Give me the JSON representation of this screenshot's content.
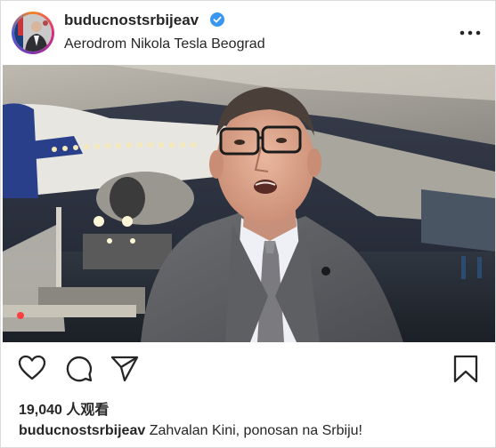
{
  "post": {
    "username": "buducnostsrbijeav",
    "location": "Aerodrom Nikola Tesla Beograd",
    "views": "19,040 人观看",
    "caption_user": "buducnostsrbijeav",
    "caption_text": "Zahvalan Kini, ponosan na Srbiju!",
    "icons": {
      "verified": "verified-badge-icon",
      "more": "more-options-icon",
      "like": "heart-icon",
      "comment": "comment-bubble-icon",
      "share": "paper-plane-icon",
      "save": "bookmark-icon"
    },
    "colors": {
      "verified": "#3897f0",
      "text": "#262626",
      "border": "#dbdbdb"
    }
  }
}
